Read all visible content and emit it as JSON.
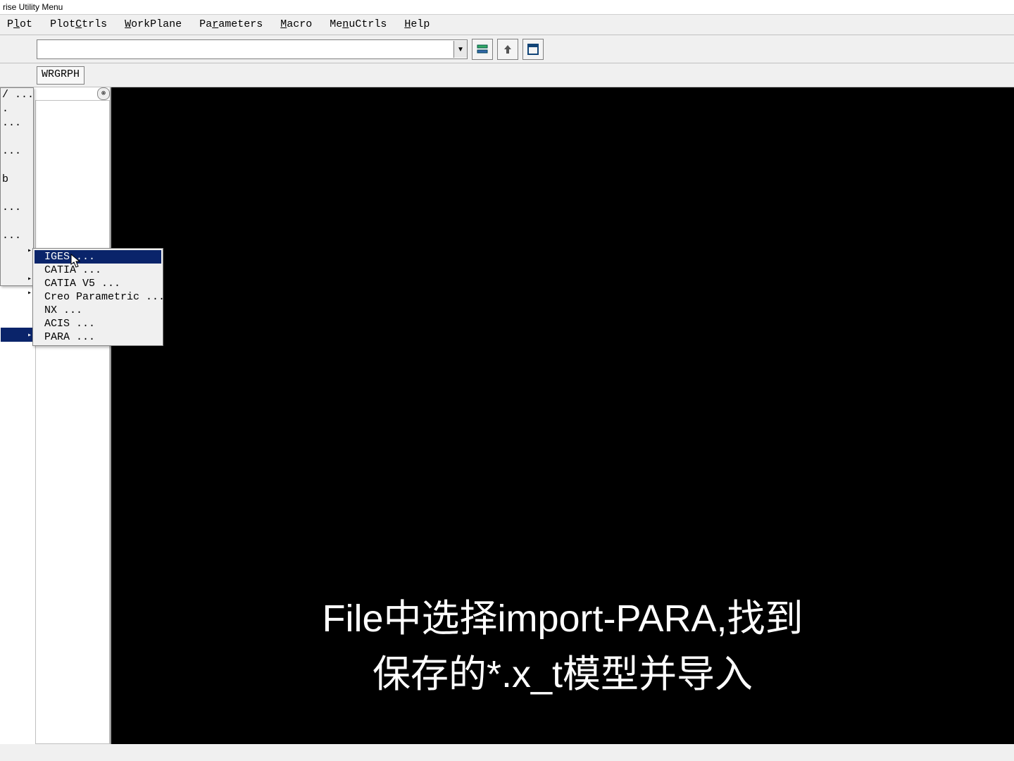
{
  "title": "rise Utility Menu",
  "menus": {
    "plot": {
      "pre": "P",
      "u": "l",
      "post": "ot"
    },
    "plotctrls": {
      "pre": "Plot",
      "u": "C",
      "post": "trls"
    },
    "workplane": {
      "pre": "",
      "u": "W",
      "post": "orkPlane"
    },
    "parameters": {
      "pre": "Pa",
      "u": "r",
      "post": "ameters"
    },
    "macro": {
      "pre": "",
      "u": "M",
      "post": "acro"
    },
    "menuctrls": {
      "pre": "Me",
      "u": "n",
      "post": "uCtrls"
    },
    "help": {
      "pre": "",
      "u": "H",
      "post": "elp"
    }
  },
  "toolbar2_btn": "WRGRPH",
  "file_col": {
    "items": [
      "/ ...",
      ".",
      "...",
      "",
      "...",
      "",
      "b",
      "",
      "...",
      "",
      "..."
    ],
    "arrow_rows": [
      1,
      2,
      3
    ],
    "highlighted_arrow_row": 0
  },
  "submenu": {
    "items": [
      "IGES ...",
      "CATIA ...",
      "CATIA V5 ...",
      "Creo Parametric ...",
      "NX ...",
      "ACIS ...",
      "PARA ..."
    ],
    "highlighted": 0
  },
  "caption_line1": "File中选择import-PARA,找到",
  "caption_line2": "保存的*.x_t模型并导入",
  "side_collapse_glyph": "⊗",
  "dd_glyph": "▾"
}
